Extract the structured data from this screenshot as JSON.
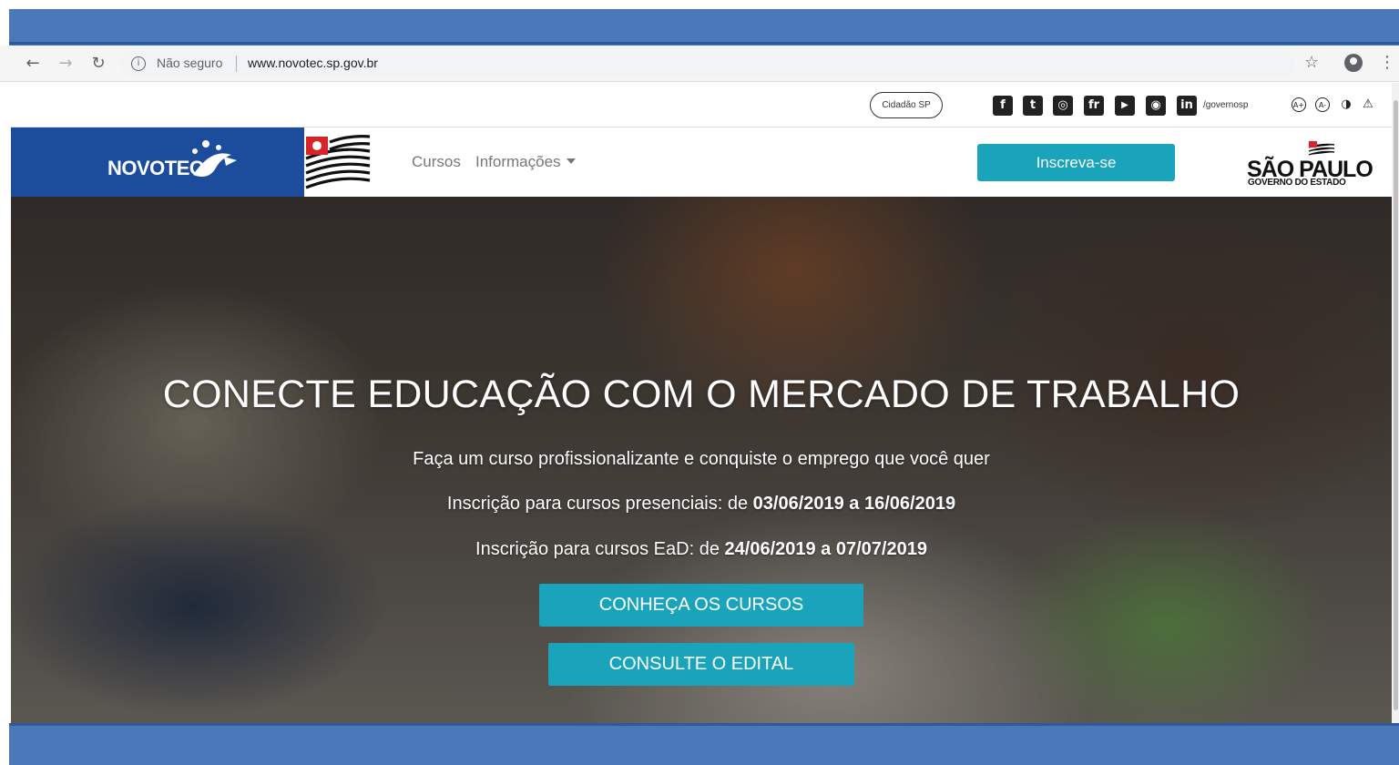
{
  "browser": {
    "security_label": "Não seguro",
    "url": "www.novotec.sp.gov.br",
    "icons": [
      "back-icon",
      "forward-icon",
      "reload-icon",
      "info-icon",
      "star-icon",
      "account-icon",
      "menu-icon"
    ]
  },
  "utility_bar": {
    "cidadao_label": "Cidadão SP",
    "social": [
      {
        "name": "facebook-icon",
        "glyph": "f"
      },
      {
        "name": "twitter-icon",
        "glyph": "t"
      },
      {
        "name": "instagram-icon",
        "glyph": "◎"
      },
      {
        "name": "flickr-icon",
        "glyph": "fr"
      },
      {
        "name": "youtube-icon",
        "glyph": "▶"
      },
      {
        "name": "periscope-icon",
        "glyph": "◉"
      },
      {
        "name": "linkedin-icon",
        "glyph": "in"
      }
    ],
    "handle": "/governosp",
    "accessibility": [
      {
        "name": "font-increase-icon",
        "glyph": "A+"
      },
      {
        "name": "font-decrease-icon",
        "glyph": "A-"
      },
      {
        "name": "contrast-icon",
        "glyph": "◑"
      },
      {
        "name": "warning-icon",
        "glyph": "⚠"
      }
    ]
  },
  "header": {
    "logo_text": "NOVOTEC",
    "nav_cursos": "Cursos",
    "nav_informacoes": "Informações",
    "cta_label": "Inscreva-se",
    "gov_title": "SÃO PAULO",
    "gov_subtitle": "GOVERNO DO ESTADO",
    "colors": {
      "logo_bg": "#1c4d9c",
      "accent": "#1aa4bb"
    }
  },
  "hero": {
    "title": "CONECTE EDUCAÇÃO COM O MERCADO DE TRABALHO",
    "subtitle": "Faça um curso profissionalizante e conquiste o emprego que você quer",
    "presencial_prefix": "Inscrição para cursos presenciais: de ",
    "presencial_dates": "03/06/2019 a 16/06/2019",
    "ead_prefix": "Inscrição para cursos EaD: de ",
    "ead_dates": "24/06/2019 a 07/07/2019",
    "button_cursos": "CONHEÇA OS CURSOS",
    "button_edital": "CONSULTE O EDITAL"
  }
}
